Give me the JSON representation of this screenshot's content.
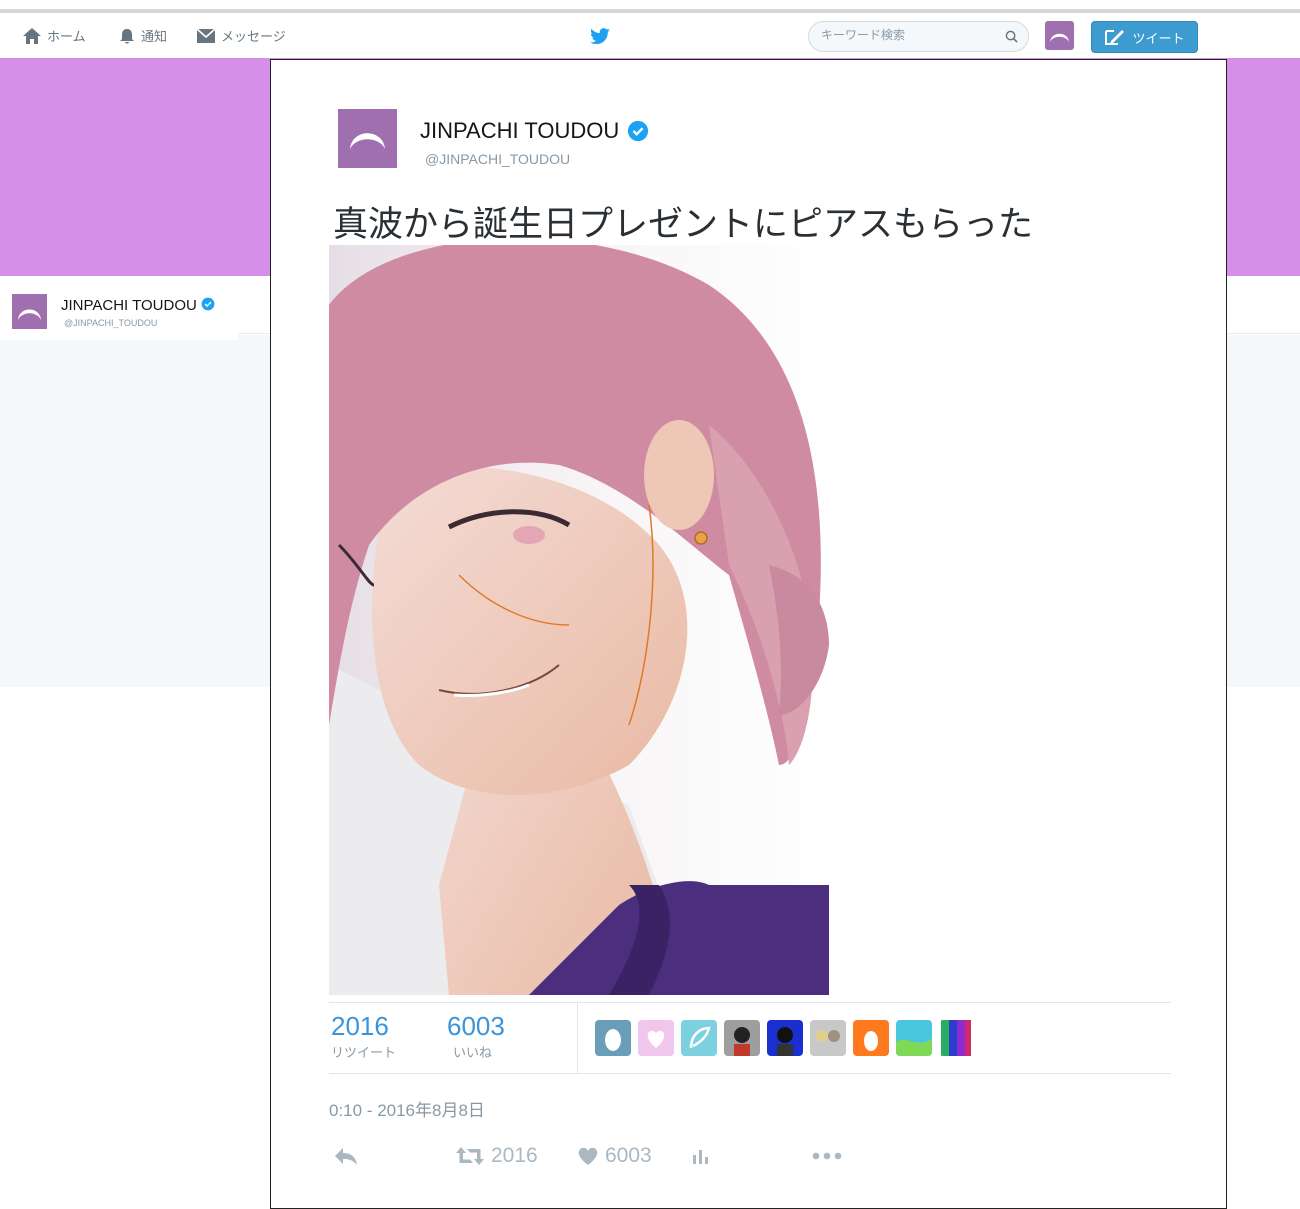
{
  "nav": {
    "home_label": "ホーム",
    "notifications_label": "通知",
    "messages_label": "メッセージ",
    "search_placeholder": "キーワード検索",
    "tweet_button_label": "ツイート"
  },
  "profile": {
    "display_name": "JINPACHI TOUDOU",
    "handle": "@JINPACHI_TOUDOU",
    "verified": true
  },
  "tweet": {
    "author_name": "JINPACHI TOUDOU",
    "author_handle": "@JINPACHI_TOUDOU",
    "text": "真波から誕生日プレゼントにピアスもらった",
    "retweets_count": "2016",
    "retweets_label": "リツイート",
    "likes_count": "6003",
    "likes_label": "いいね",
    "timestamp": "0:10 - 2016年8月8日",
    "action_retweet_count": "2016",
    "action_like_count": "6003"
  },
  "colors": {
    "brand_blue": "#1da1f2",
    "banner": "#d68fe8",
    "avatar_bg": "#a06fb0",
    "stat_blue": "#3b94d9"
  },
  "icons": [
    "home-icon",
    "bell-icon",
    "envelope-icon",
    "twitter-bird-icon",
    "search-icon",
    "compose-icon",
    "verified-badge-icon",
    "reply-icon",
    "retweet-icon",
    "heart-icon",
    "analytics-icon",
    "more-icon"
  ]
}
